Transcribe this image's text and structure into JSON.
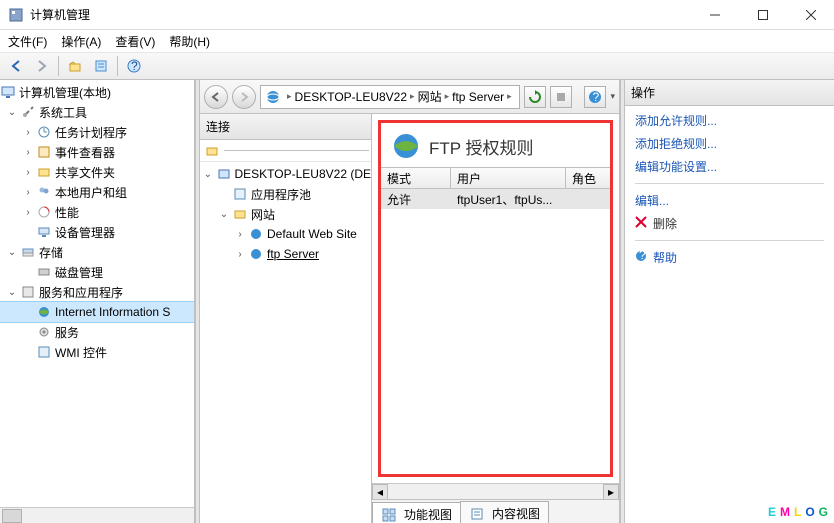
{
  "window": {
    "title": "计算机管理"
  },
  "menubar": {
    "file": "文件(F)",
    "action": "操作(A)",
    "view": "查看(V)",
    "help": "帮助(H)"
  },
  "tree": {
    "root": "计算机管理(本地)",
    "sys_tools": "系统工具",
    "task_sched": "任务计划程序",
    "event_viewer": "事件查看器",
    "shared_folders": "共享文件夹",
    "local_users": "本地用户和组",
    "perf": "性能",
    "dev_mgr": "设备管理器",
    "storage": "存储",
    "disk_mgr": "磁盘管理",
    "svc_apps": "服务和应用程序",
    "iis": "Internet Information S",
    "services": "服务",
    "wmi": "WMI 控件"
  },
  "breadcrumb": {
    "server": "DESKTOP-LEU8V22",
    "sites": "网站",
    "site": "ftp Server"
  },
  "connections": {
    "title": "连接",
    "server": "DESKTOP-LEU8V22 (DE",
    "app_pools": "应用程序池",
    "sites": "网站",
    "default_site": "Default Web Site",
    "ftp_site": "ftp Server"
  },
  "main_panel": {
    "title": "FTP 授权规则",
    "col_mode": "模式",
    "col_user": "用户",
    "col_role": "角色",
    "rows": [
      {
        "mode": "允许",
        "user": "ftpUser1、ftpUs...",
        "role": ""
      }
    ]
  },
  "tabs": {
    "features": "功能视图",
    "content": "内容视图"
  },
  "actions": {
    "title": "操作",
    "add_allow": "添加允许规则...",
    "add_deny": "添加拒绝规则...",
    "edit_feature": "编辑功能设置...",
    "edit": "编辑...",
    "delete": "删除",
    "help": "帮助"
  },
  "watermark": "EMLOG"
}
